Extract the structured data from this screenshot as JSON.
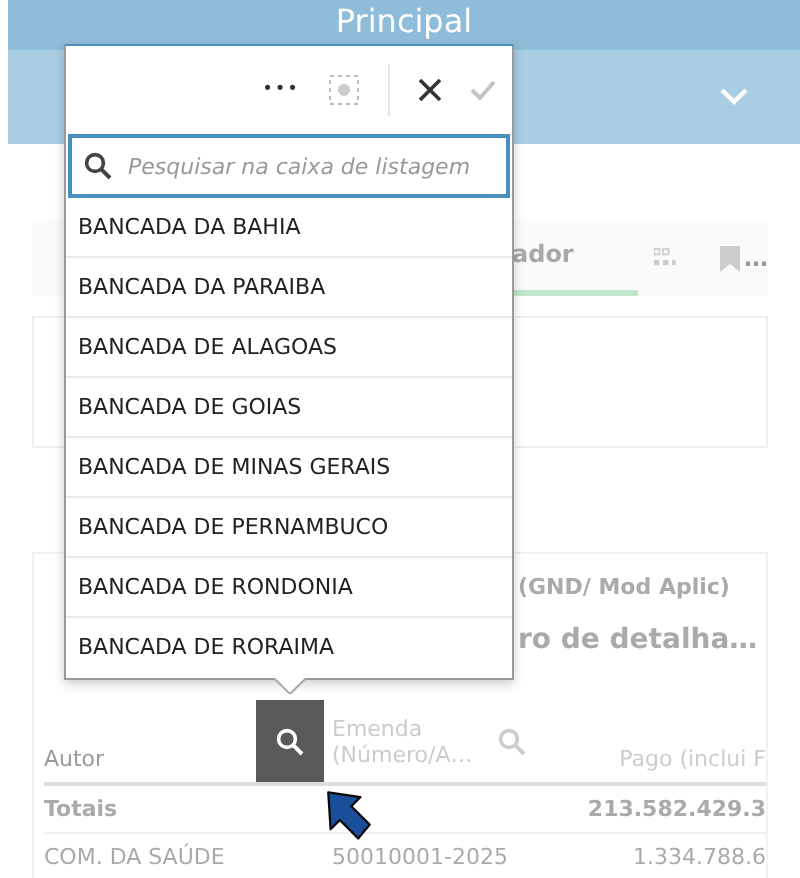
{
  "header": {
    "title": "Principal"
  },
  "background": {
    "tab_label": "ador",
    "tab_more": "…",
    "panel_title": "(GND/ Mod Aplic)",
    "panel_subtitle": "ro de detalha…"
  },
  "table": {
    "columns": [
      {
        "label": "Autor",
        "search_active": true
      },
      {
        "label": "Emenda (Número/A…",
        "search_active": false
      },
      {
        "label": "Pago (inclui F"
      }
    ],
    "totals": {
      "label": "Totais",
      "value": "213.582.429.3"
    },
    "rows": [
      {
        "cells": [
          "COM. DA SAÚDE",
          "50010001-2025",
          "1.334.788.6"
        ]
      }
    ]
  },
  "listbox": {
    "toolbar": {
      "more": "•••",
      "confirm_disabled": true
    },
    "search": {
      "placeholder": "Pesquisar na caixa de listagem"
    },
    "items": [
      "BANCADA DA BAHIA",
      "BANCADA DA PARAIBA",
      "BANCADA DE ALAGOAS",
      "BANCADA DE GOIAS",
      "BANCADA DE MINAS GERAIS",
      "BANCADA DE PERNAMBUCO",
      "BANCADA DE RONDONIA",
      "BANCADA DE RORAIMA"
    ]
  }
}
